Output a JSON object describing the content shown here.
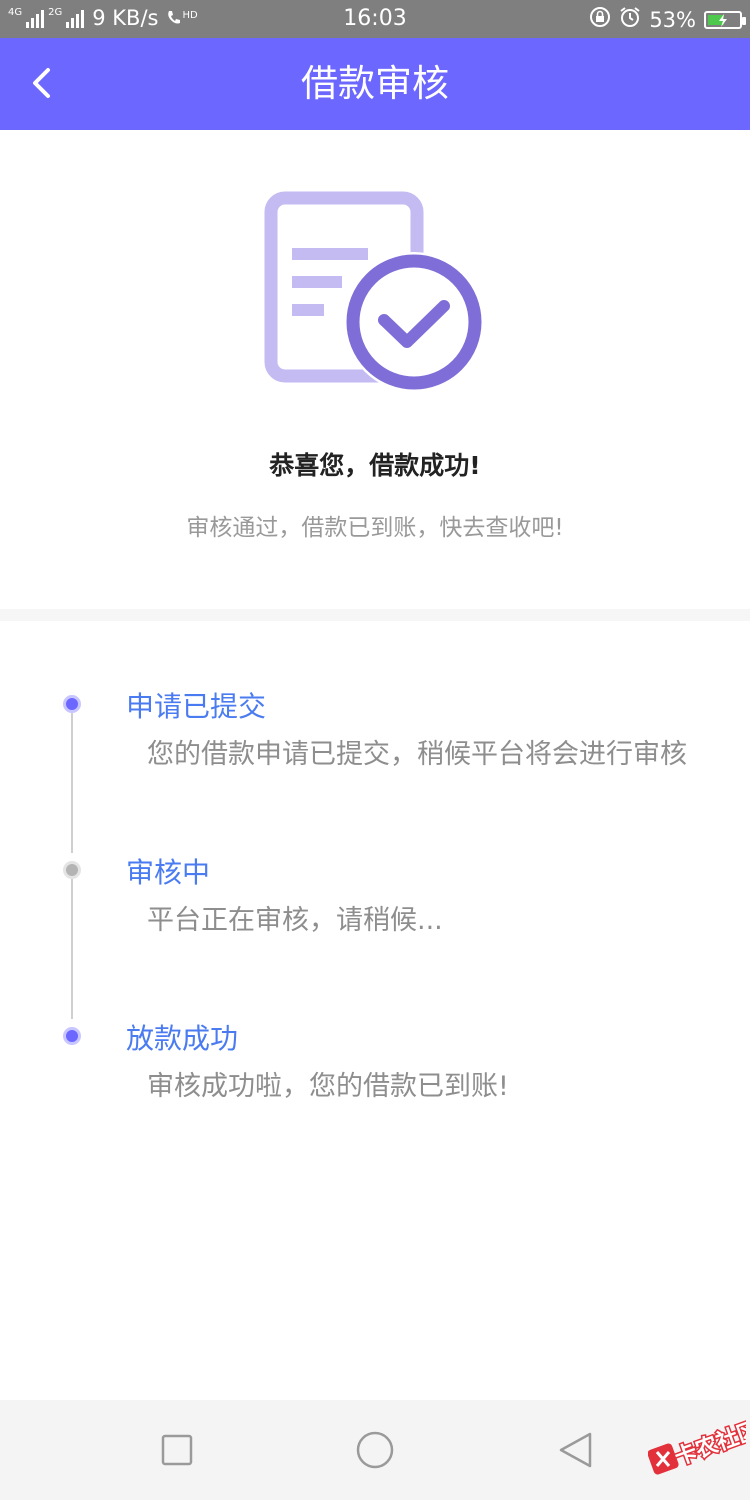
{
  "status_bar": {
    "network_left": "4G",
    "network_right": "2G",
    "speed": "9 KB/s",
    "call_badge": "HD",
    "time": "16:03",
    "battery_percent": "53%",
    "battery_level": 0.53,
    "charging": true,
    "battery_fill_color": "#4ec94e"
  },
  "header": {
    "title": "借款审核",
    "back_icon": "chevron-left-icon",
    "background": "#6c67ff"
  },
  "success": {
    "illustration_icon": "document-check-icon",
    "title": "恭喜您，借款成功!",
    "subtitle": "审核通过，借款已到账，快去查收吧!"
  },
  "timeline": {
    "steps": [
      {
        "title": "申请已提交",
        "description": "您的借款申请已提交，稍候平台将会进行审核",
        "state": "done"
      },
      {
        "title": "审核中",
        "description": "平台正在审核，请稍候...",
        "state": "pending"
      },
      {
        "title": "放款成功",
        "description": "审核成功啦，您的借款已到账!",
        "state": "done"
      }
    ]
  },
  "nav_bar": {
    "recent_icon": "square-recent-icon",
    "home_icon": "circle-home-icon",
    "back_icon": "triangle-back-icon"
  },
  "watermark": {
    "text": "卡农社区"
  }
}
